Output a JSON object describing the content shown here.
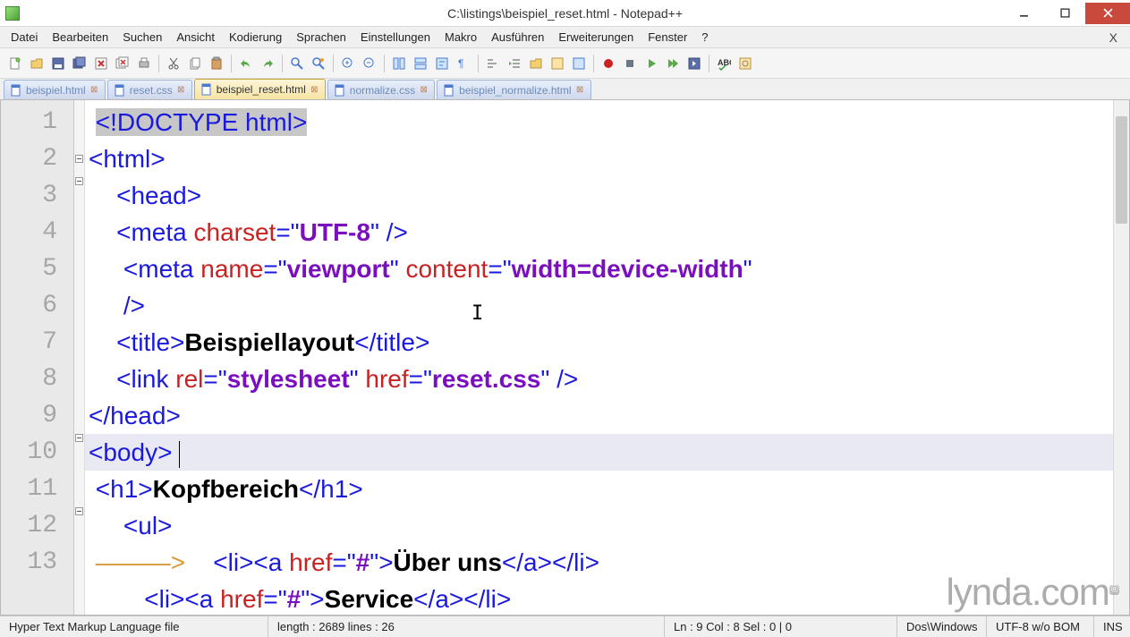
{
  "window": {
    "title": "C:\\listings\\beispiel_reset.html - Notepad++"
  },
  "menu": {
    "items": [
      "Datei",
      "Bearbeiten",
      "Suchen",
      "Ansicht",
      "Kodierung",
      "Sprachen",
      "Einstellungen",
      "Makro",
      "Ausführen",
      "Erweiterungen",
      "Fenster",
      "?"
    ]
  },
  "tabs": [
    {
      "label": "beispiel.html",
      "active": false
    },
    {
      "label": "reset.css",
      "active": false
    },
    {
      "label": "beispiel_reset.html",
      "active": true
    },
    {
      "label": "normalize.css",
      "active": false
    },
    {
      "label": "beispiel_normalize.html",
      "active": false
    }
  ],
  "gutter": [
    "1",
    "2",
    "3",
    "4",
    "5",
    "6",
    "7",
    "8",
    "9",
    "10",
    "11",
    "12",
    "13"
  ],
  "code": {
    "l1a": "<!DOCTYPE html>",
    "l2": "<",
    "l2b": "html",
    "l2c": ">",
    "l3": "    <",
    "l3b": "head",
    "l3c": ">",
    "l4": "    <",
    "l4b": "meta ",
    "l4c": "charset",
    "l4d": "=\"",
    "l4e": "UTF-8",
    "l4f": "\" />",
    "l5": "     <",
    "l5b": "meta ",
    "l5c": "name",
    "l5d": "=\"",
    "l5e": "viewport",
    "l5f": "\" ",
    "l5g": "content",
    "l5h": "=\"",
    "l5i": "width=device-width",
    "l5j": "\"",
    "l5k": "     />",
    "l6": "    <",
    "l6b": "title",
    "l6c": ">",
    "l6d": "Beispiellayout",
    "l6e": "</",
    "l6f": "title",
    "l6g": ">",
    "l7": "    <",
    "l7b": "link ",
    "l7c": "rel",
    "l7d": "=\"",
    "l7e": "stylesheet",
    "l7f": "\" ",
    "l7g": "href",
    "l7h": "=\"",
    "l7i": "reset.css",
    "l7j": "\" />",
    "l8": "</",
    "l8b": "head",
    "l8c": ">",
    "l9": "<",
    "l9b": "body",
    "l9c": "> ",
    "l10": " <",
    "l10b": "h1",
    "l10c": ">",
    "l10d": "Kopfbereich",
    "l10e": "</",
    "l10f": "h1",
    "l10g": ">",
    "l11": "     <",
    "l11b": "ul",
    "l11c": ">",
    "l12a": "———>",
    "l12": "    <",
    "l12b": "li",
    "l12c": "><",
    "l12d": "a ",
    "l12e": "href",
    "l12f": "=\"",
    "l12g": "#",
    "l12h": "\">",
    "l12i": "Über uns",
    "l12j": "</",
    "l12k": "a",
    "l12l": "></",
    "l12m": "li",
    "l12n": ">",
    "l13": "        <",
    "l13b": "li",
    "l13c": "><",
    "l13d": "a ",
    "l13e": "href",
    "l13f": "=\"",
    "l13g": "#",
    "l13h": "\">",
    "l13i": "Service",
    "l13j": "</",
    "l13k": "a",
    "l13l": "></",
    "l13m": "li",
    "l13n": ">"
  },
  "status": {
    "lang": "Hyper Text Markup Language file",
    "length": "length : 2689    lines : 26",
    "pos": "Ln : 9    Col : 8    Sel : 0 | 0",
    "eol": "Dos\\Windows",
    "enc": "UTF-8 w/o BOM",
    "mode": "INS"
  },
  "watermark": "lynda.com"
}
